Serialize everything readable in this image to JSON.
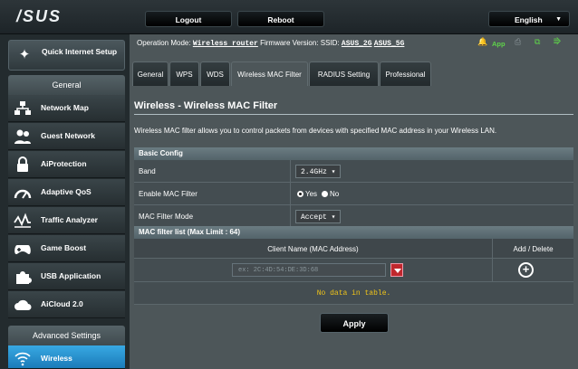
{
  "brand": {
    "logo": "/SUS"
  },
  "topbar": {
    "logout": "Logout",
    "reboot": "Reboot",
    "language": "English"
  },
  "sidebar": {
    "qis": "Quick Internet Setup",
    "general_header": "General",
    "items": [
      {
        "label": "Network Map",
        "icon": "network-map-icon"
      },
      {
        "label": "Guest Network",
        "icon": "guest-network-icon"
      },
      {
        "label": "AiProtection",
        "icon": "lock-icon"
      },
      {
        "label": "Adaptive QoS",
        "icon": "gauge-icon"
      },
      {
        "label": "Traffic Analyzer",
        "icon": "traffic-analyzer-icon"
      },
      {
        "label": "Game Boost",
        "icon": "gamepad-icon"
      },
      {
        "label": "USB Application",
        "icon": "puzzle-icon"
      },
      {
        "label": "AiCloud 2.0",
        "icon": "cloud-icon"
      }
    ],
    "advanced_header": "Advanced Settings",
    "advanced_items": [
      {
        "label": "Wireless",
        "icon": "wifi-icon",
        "active": true
      }
    ]
  },
  "status": {
    "op_mode_label": "Operation Mode:",
    "op_mode": "Wireless router",
    "fw_label": "Firmware Version:",
    "ssid_label": "SSID:",
    "ssid_2g": "ASUS_2G",
    "ssid_5g": "ASUS_5G",
    "app_label": "App"
  },
  "tabs": [
    {
      "label": "General"
    },
    {
      "label": "WPS"
    },
    {
      "label": "WDS"
    },
    {
      "label": "Wireless MAC Filter",
      "active": true
    },
    {
      "label": "RADIUS Setting"
    },
    {
      "label": "Professional"
    }
  ],
  "page": {
    "title": "Wireless - Wireless MAC Filter",
    "description": "Wireless MAC filter allows you to control packets from devices with specified MAC address in your Wireless LAN.",
    "basic_config": "Basic Config",
    "band_label": "Band",
    "band_value": "2.4GHz",
    "enable_label": "Enable MAC Filter",
    "yes": "Yes",
    "no": "No",
    "mode_label": "MAC Filter Mode",
    "mode_value": "Accept",
    "list_title": "MAC filter list (Max Limit : 64)",
    "col_client": "Client Name (MAC Address)",
    "col_action": "Add / Delete",
    "mac_placeholder": "ex: 2C:4D:54:DE:3D:68",
    "no_data": "No data in table.",
    "apply": "Apply"
  },
  "colors": {
    "accent": "#1b7bb9",
    "warning": "#f0c419",
    "drop": "#c0272d"
  }
}
